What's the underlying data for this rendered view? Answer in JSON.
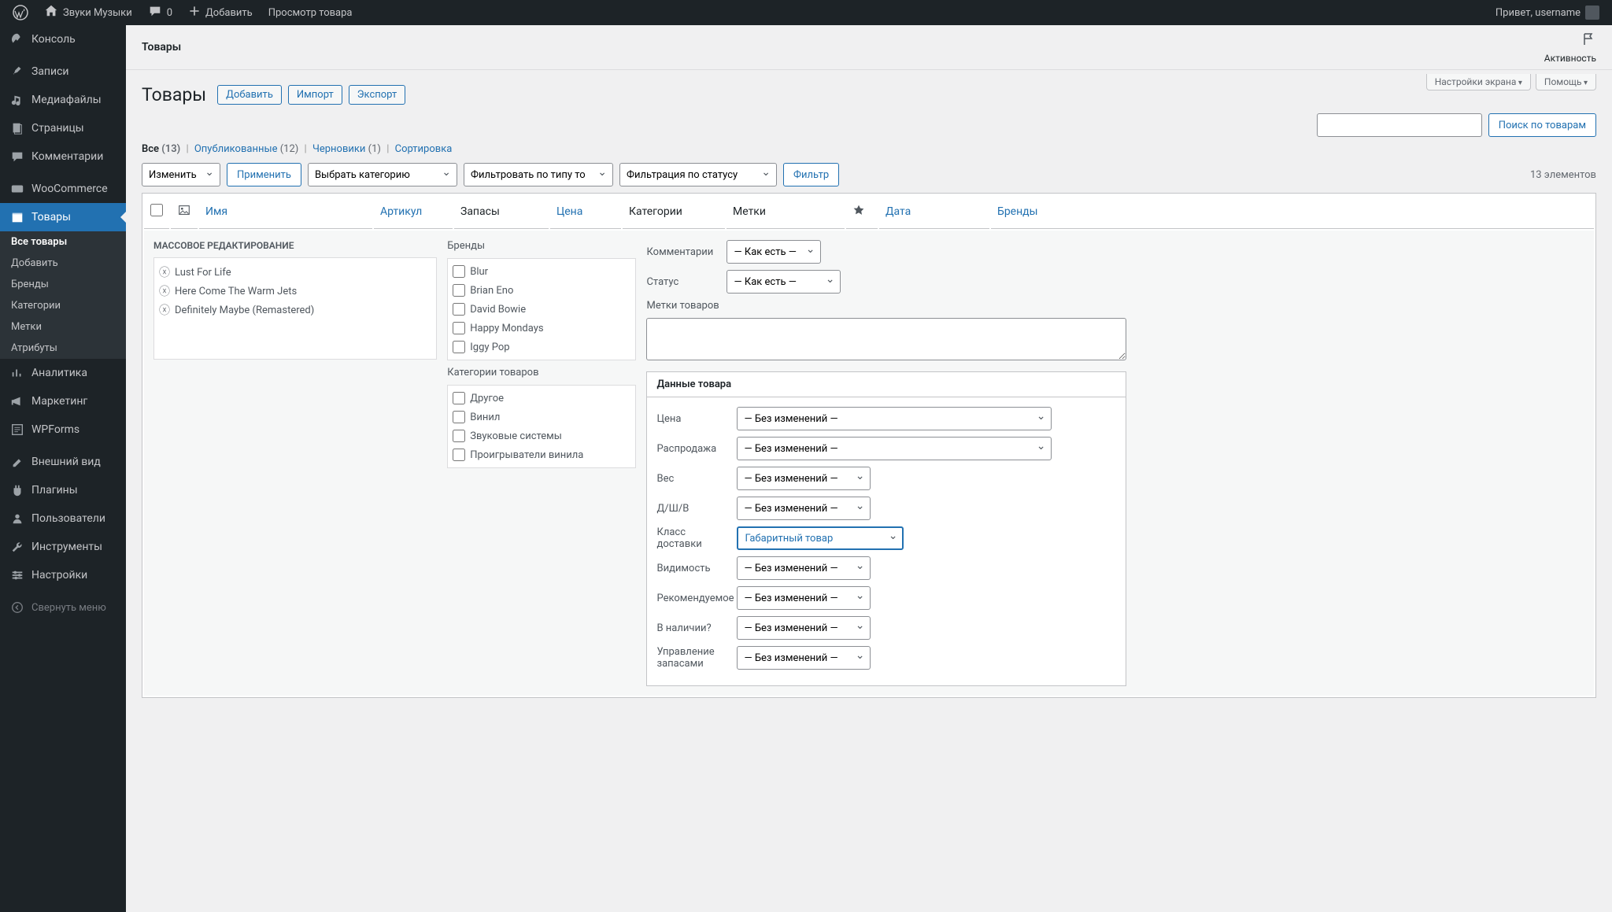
{
  "adminbar": {
    "site_name": "Звуки Музыки",
    "comments_count": "0",
    "add_new": "Добавить",
    "view_product": "Просмотр товара",
    "howdy": "Привет, username"
  },
  "sidebar": {
    "items": [
      {
        "label": "Консоль",
        "icon": "dashboard"
      },
      {
        "label": "Записи",
        "icon": "pin"
      },
      {
        "label": "Медиафайлы",
        "icon": "media"
      },
      {
        "label": "Страницы",
        "icon": "pages"
      },
      {
        "label": "Комментарии",
        "icon": "comments"
      },
      {
        "label": "WooCommerce",
        "icon": "woo"
      },
      {
        "label": "Товары",
        "icon": "products",
        "current": true
      },
      {
        "label": "Аналитика",
        "icon": "analytics"
      },
      {
        "label": "Маркетинг",
        "icon": "marketing"
      },
      {
        "label": "WPForms",
        "icon": "wpforms"
      },
      {
        "label": "Внешний вид",
        "icon": "appearance"
      },
      {
        "label": "Плагины",
        "icon": "plugins"
      },
      {
        "label": "Пользователи",
        "icon": "users"
      },
      {
        "label": "Инструменты",
        "icon": "tools"
      },
      {
        "label": "Настройки",
        "icon": "settings"
      }
    ],
    "submenu_products": [
      {
        "label": "Все товары",
        "current": true
      },
      {
        "label": "Добавить"
      },
      {
        "label": "Бренды"
      },
      {
        "label": "Категории"
      },
      {
        "label": "Метки"
      },
      {
        "label": "Атрибуты"
      }
    ],
    "collapse": "Свернуть меню"
  },
  "topstrip": {
    "title": "Товары",
    "activity": "Активность"
  },
  "screen_meta": {
    "options": "Настройки экрана",
    "help": "Помощь"
  },
  "page": {
    "heading": "Товары",
    "add": "Добавить",
    "import": "Импорт",
    "export": "Экспорт"
  },
  "views": {
    "all": "Все",
    "all_count": "(13)",
    "published": "Опубликованные",
    "published_count": "(12)",
    "drafts": "Черновики",
    "drafts_count": "(1)",
    "sorting": "Сортировка"
  },
  "search": {
    "button": "Поиск по товарам"
  },
  "bulk_actions": {
    "action": "Изменить",
    "apply": "Применить",
    "category": "Выбрать категорию",
    "type": "Фильтровать по типу то",
    "status": "Фильтрация по статусу",
    "filter": "Фильтр",
    "count": "13 элементов"
  },
  "table": {
    "cols": {
      "name": "Имя",
      "sku": "Артикул",
      "stock": "Запасы",
      "price": "Цена",
      "categories": "Категории",
      "tags": "Метки",
      "date": "Дата",
      "brands": "Бренды"
    }
  },
  "bulk_edit": {
    "title": "МАССОВОЕ РЕДАКТИРОВАНИЕ",
    "items": [
      "Lust For Life",
      "Here Come The Warm Jets",
      "Definitely Maybe (Remastered)"
    ],
    "brands_label": "Бренды",
    "brands": [
      "Blur",
      "Brian Eno",
      "David Bowie",
      "Happy Mondays",
      "Iggy Pop"
    ],
    "categories_label": "Категории товаров",
    "categories": [
      "Другое",
      "Винил",
      "Звуковые системы",
      "Проигрыватели винила"
    ],
    "comments_label": "Комментарии",
    "status_label": "Статус",
    "tags_label": "Метки товаров",
    "as_is": "— Как есть —"
  },
  "product_data": {
    "title": "Данные товара",
    "no_change": "— Без изменений —",
    "rows": {
      "price": "Цена",
      "sale": "Распродажа",
      "weight": "Вес",
      "dims": "Д/Ш/В",
      "shipping_class": "Класс доставки",
      "shipping_class_value": "Габаритный товар",
      "visibility": "Видимость",
      "featured": "Рекомендуемое",
      "in_stock": "В наличии?",
      "manage_stock": "Управление запасами"
    }
  }
}
